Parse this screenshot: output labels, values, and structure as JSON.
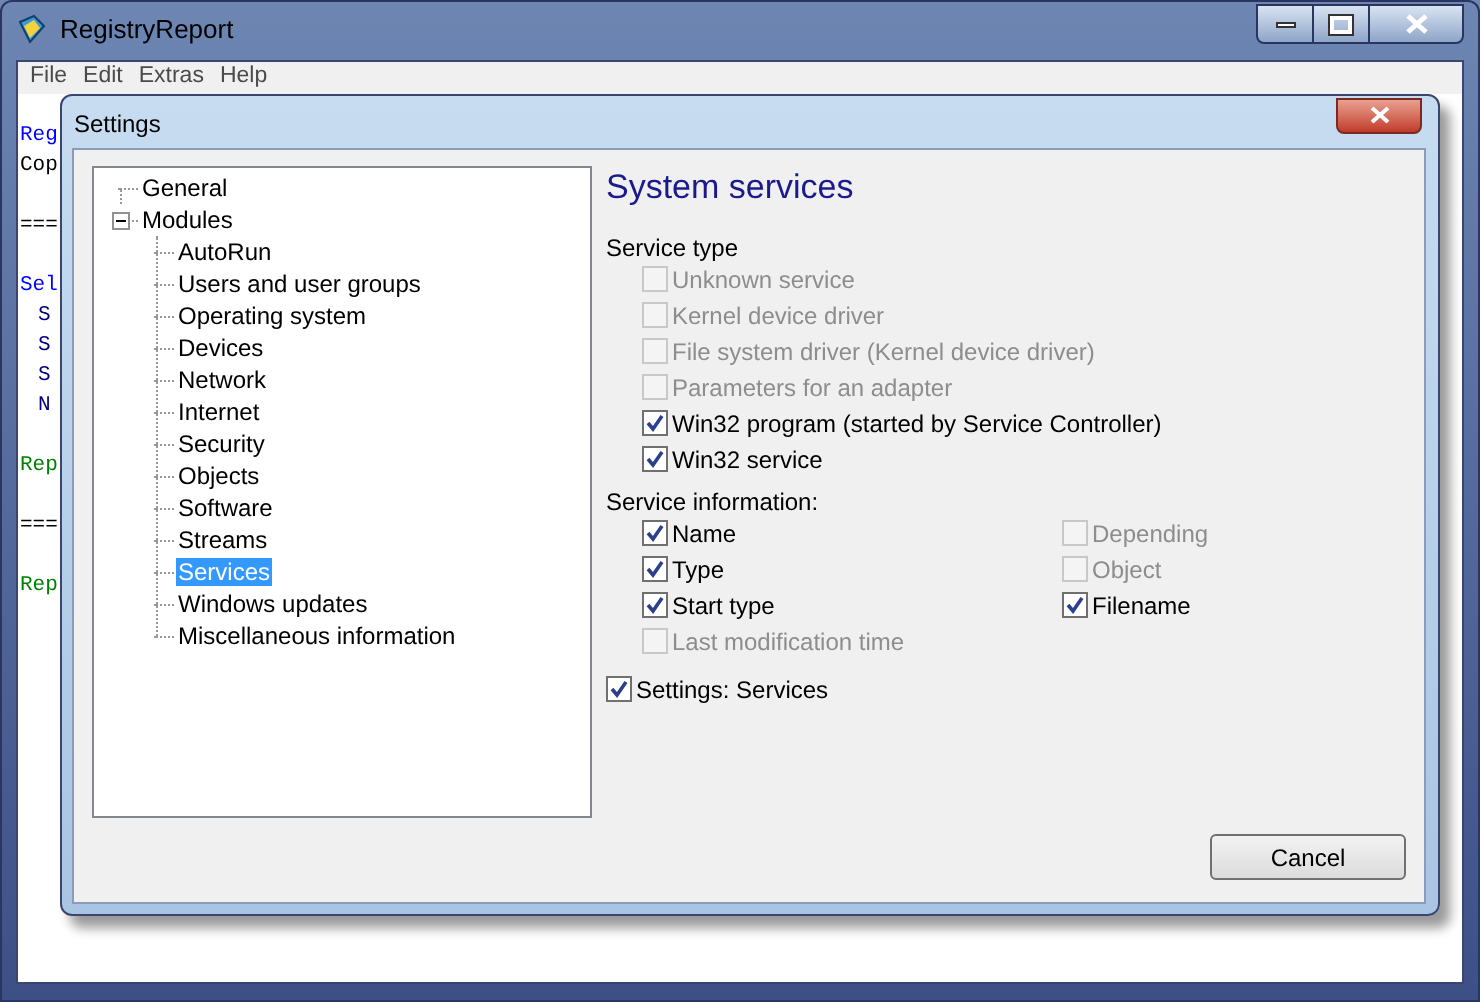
{
  "window": {
    "title": "RegistryReport"
  },
  "menu": [
    "File",
    "Edit",
    "Extras",
    "Help"
  ],
  "log_lines": [
    {
      "text": "Reg",
      "color": "#0000ff"
    },
    {
      "text": "Cop",
      "color": "#000000"
    },
    {
      "text": "===",
      "color": "#000000"
    },
    {
      "text": "Sel",
      "color": "#0000ff",
      "children": [
        {
          "text": "S",
          "color": "#000080"
        },
        {
          "text": "S",
          "color": "#000080"
        },
        {
          "text": "S",
          "color": "#000080"
        },
        {
          "text": "N",
          "color": "#000080"
        }
      ]
    },
    {
      "text": "Rep",
      "color": "#008000"
    },
    {
      "text": "===",
      "color": "#000000"
    },
    {
      "text": "Rep",
      "color": "#008000"
    }
  ],
  "dialog": {
    "title": "Settings",
    "tree": [
      {
        "label": "General",
        "selected": false
      },
      {
        "label": "Modules",
        "selected": false,
        "expanded": true,
        "children": [
          {
            "label": "AutoRun",
            "selected": false
          },
          {
            "label": "Users and user groups",
            "selected": false
          },
          {
            "label": "Operating system",
            "selected": false
          },
          {
            "label": "Devices",
            "selected": false
          },
          {
            "label": "Network",
            "selected": false
          },
          {
            "label": "Internet",
            "selected": false
          },
          {
            "label": "Security",
            "selected": false
          },
          {
            "label": "Objects",
            "selected": false
          },
          {
            "label": "Software",
            "selected": false
          },
          {
            "label": "Streams",
            "selected": false
          },
          {
            "label": "Services",
            "selected": true
          },
          {
            "label": "Windows updates",
            "selected": false
          },
          {
            "label": "Miscellaneous information",
            "selected": false
          }
        ]
      }
    ],
    "heading": "System services",
    "service_type": {
      "label": "Service type",
      "options": [
        {
          "label": "Unknown service",
          "checked": false,
          "disabled": true
        },
        {
          "label": "Kernel device driver",
          "checked": false,
          "disabled": true
        },
        {
          "label": "File system driver (Kernel device driver)",
          "checked": false,
          "disabled": true
        },
        {
          "label": "Parameters for an adapter",
          "checked": false,
          "disabled": true
        },
        {
          "label": "Win32 program (started by Service Controller)",
          "checked": true,
          "disabled": false
        },
        {
          "label": "Win32 service",
          "checked": true,
          "disabled": false
        }
      ]
    },
    "service_information": {
      "label": "Service information:",
      "columns": [
        [
          {
            "label": "Name",
            "checked": true,
            "disabled": false
          },
          {
            "label": "Type",
            "checked": true,
            "disabled": false
          },
          {
            "label": "Start type",
            "checked": true,
            "disabled": false
          },
          {
            "label": "Last modification time",
            "checked": false,
            "disabled": true
          }
        ],
        [
          {
            "label": "Depending",
            "checked": false,
            "disabled": true
          },
          {
            "label": "Object",
            "checked": false,
            "disabled": true
          },
          {
            "label": "Filename",
            "checked": true,
            "disabled": false
          }
        ]
      ]
    },
    "module_setting": {
      "label": "Settings: Services",
      "checked": true,
      "disabled": false
    },
    "cancel": "Cancel"
  }
}
